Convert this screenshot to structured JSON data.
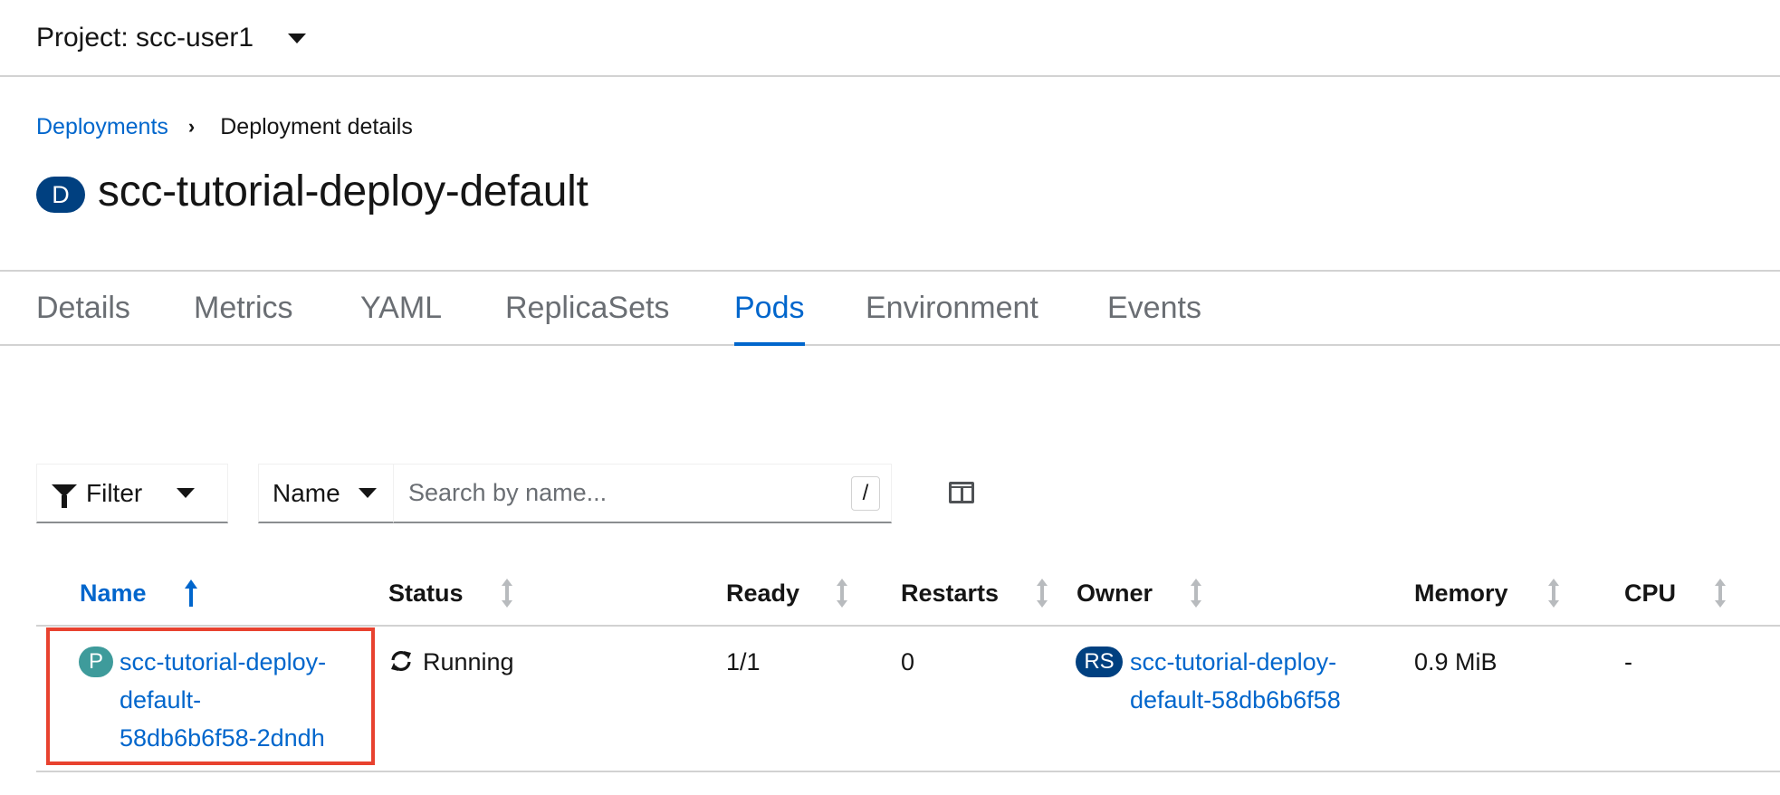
{
  "project": {
    "label": "Project: scc-user1"
  },
  "breadcrumb": {
    "parent": "Deployments",
    "separator": "›",
    "current": "Deployment details"
  },
  "resource": {
    "badge": "D",
    "title": "scc-tutorial-deploy-default"
  },
  "tabs": [
    {
      "label": "Details"
    },
    {
      "label": "Metrics"
    },
    {
      "label": "YAML"
    },
    {
      "label": "ReplicaSets"
    },
    {
      "label": "Pods",
      "active": true
    },
    {
      "label": "Environment"
    },
    {
      "label": "Events"
    }
  ],
  "toolbar": {
    "filter_label": "Filter",
    "name_select": "Name",
    "search_placeholder": "Search by name...",
    "search_hint": "/"
  },
  "table": {
    "columns": [
      "Name",
      "Status",
      "Ready",
      "Restarts",
      "Owner",
      "Memory",
      "CPU"
    ],
    "sorted_column": "Name",
    "rows": [
      {
        "name_badge": "P",
        "name_lines": [
          "scc-tutorial-deploy-",
          "default-",
          "58db6b6f58-2dndh"
        ],
        "status": "Running",
        "ready": "1/1",
        "restarts": "0",
        "owner_badge": "RS",
        "owner_lines": [
          "scc-tutorial-deploy-",
          "default-58db6b6f58"
        ],
        "memory": "0.9 MiB",
        "cpu": "-"
      }
    ]
  },
  "colors": {
    "link": "#0066cc",
    "deployment_badge": "#004080",
    "pod_badge": "#3e9b9b",
    "replicaset_badge": "#004080",
    "highlight": "#e8422f"
  }
}
